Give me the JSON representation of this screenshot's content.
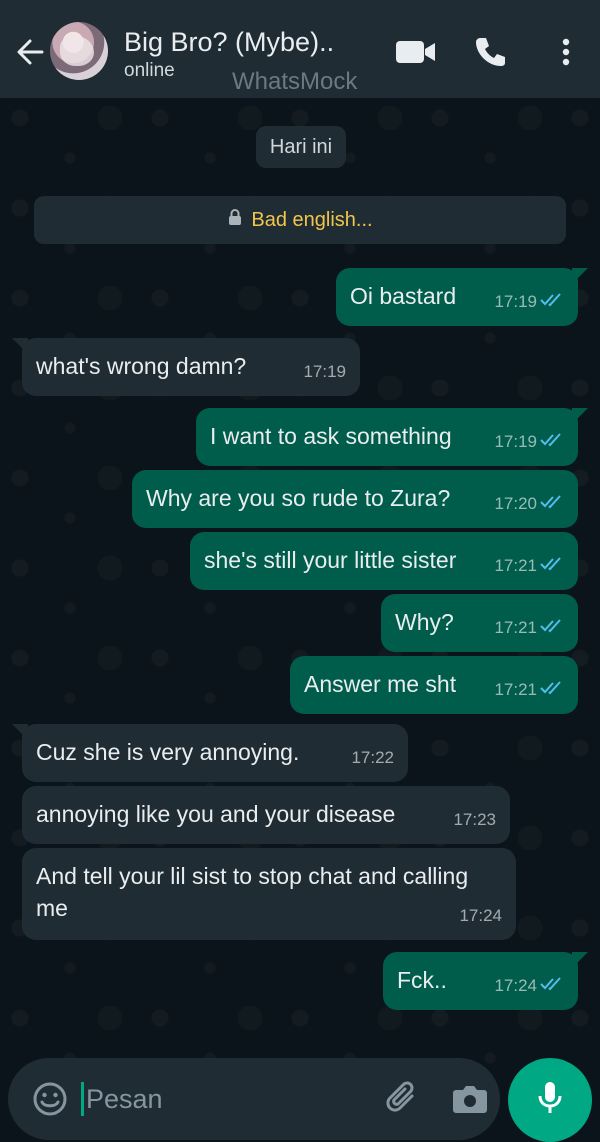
{
  "header": {
    "name": "Big Bro? (Mybe)..",
    "status": "online",
    "watermark": "WhatsMock"
  },
  "date_divider": "Hari ini",
  "notice": "Bad english...",
  "messages": [
    {
      "dir": "out",
      "text": "Oi bastard",
      "time": "17:19"
    },
    {
      "dir": "in",
      "text": "what's wrong damn?",
      "time": "17:19"
    },
    {
      "dir": "out",
      "text": "I want to ask something",
      "time": "17:19"
    },
    {
      "dir": "out",
      "text": "Why are you so rude to Zura?",
      "time": "17:20"
    },
    {
      "dir": "out",
      "text": "she's still your little sister",
      "time": "17:21"
    },
    {
      "dir": "out",
      "text": "Why?",
      "time": "17:21"
    },
    {
      "dir": "out",
      "text": "Answer me sht",
      "time": "17:21"
    },
    {
      "dir": "in",
      "text": "Cuz she is very annoying.",
      "time": "17:22"
    },
    {
      "dir": "in",
      "text": "annoying like you and your disease",
      "time": "17:23"
    },
    {
      "dir": "in",
      "text": "And tell your lil sist to stop chat and calling me",
      "time": "17:24"
    },
    {
      "dir": "out",
      "text": "Fck..",
      "time": "17:24"
    }
  ],
  "input": {
    "placeholder": "Pesan"
  },
  "colors": {
    "outgoing": "#005c4b",
    "incoming": "#202c33",
    "accent": "#00a884",
    "read_check": "#53bdeb"
  },
  "icons": [
    "back-arrow-icon",
    "video-call-icon",
    "phone-icon",
    "more-options-icon",
    "lock-icon",
    "emoji-icon",
    "attach-icon",
    "camera-icon",
    "mic-icon",
    "double-check-icon"
  ]
}
